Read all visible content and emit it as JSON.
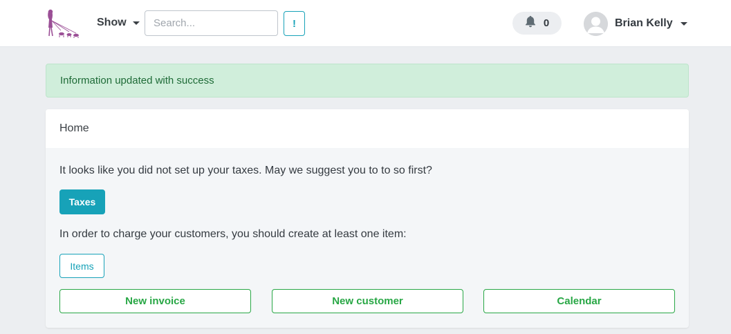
{
  "navbar": {
    "logo_icon": "dog-walker-logo-icon",
    "show_label": "Show",
    "search_placeholder": "Search...",
    "bang_label": "!",
    "notifications": {
      "icon": "bell-icon",
      "count": "0"
    },
    "user": {
      "name": "Brian Kelly",
      "avatar_icon": "user-avatar-icon"
    }
  },
  "alert": {
    "message": "Information updated with success"
  },
  "card": {
    "header": "Home",
    "taxes_text": "It looks like you did not set up your taxes. May we suggest you to to so first?",
    "taxes_button": "Taxes",
    "items_text": "In order to charge your customers, you should create at least one item:",
    "items_button": "Items",
    "actions": {
      "new_invoice": "New invoice",
      "new_customer": "New customer",
      "calendar": "Calendar"
    }
  },
  "colors": {
    "info": "#17a2b8",
    "success": "#28a745",
    "alert_bg": "#d0eedb",
    "alert_text": "#1e6b37",
    "logo": "#9b4f96"
  }
}
